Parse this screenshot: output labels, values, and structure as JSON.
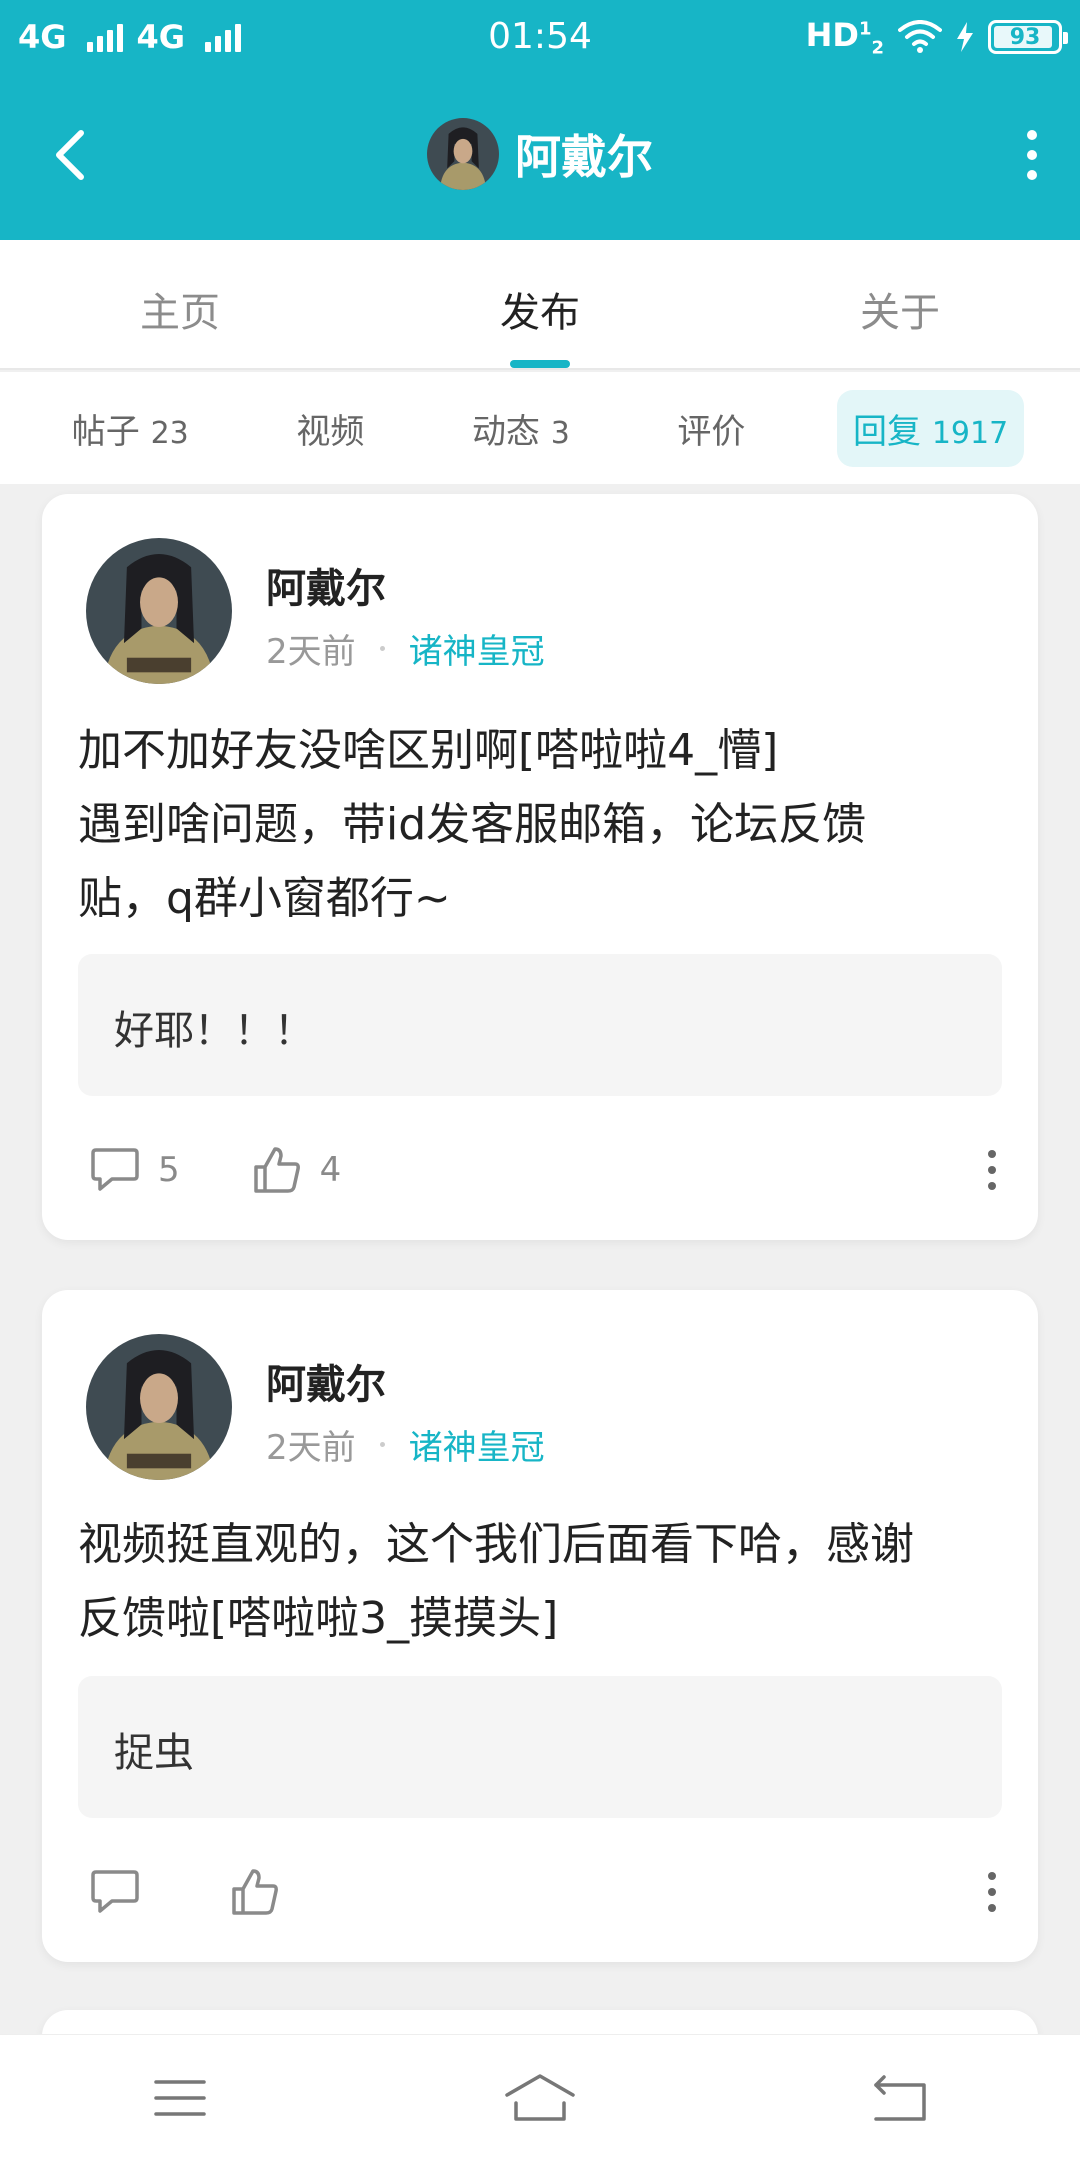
{
  "status_bar": {
    "left": [
      "4G",
      "4G"
    ],
    "time": "01:54",
    "hd": "HD",
    "hd_sup": "1",
    "hd_sub": "2",
    "battery": "93",
    "battery_level": 0.93
  },
  "header": {
    "title": "阿戴尔"
  },
  "tabs": [
    {
      "label": "主页"
    },
    {
      "label": "发布"
    },
    {
      "label": "关于"
    }
  ],
  "active_tab": "发布",
  "subtabs": [
    {
      "label": "帖子",
      "count": "23"
    },
    {
      "label": "视频",
      "count": ""
    },
    {
      "label": "动态",
      "count": "3"
    },
    {
      "label": "评价",
      "count": ""
    },
    {
      "label": "回复",
      "count": "1917"
    }
  ],
  "active_subtab": "回复",
  "posts": [
    {
      "author": "阿戴尔",
      "time": "2天前",
      "forum": "诸神皇冠",
      "lines": [
        "加不加好友没啥区别啊[嗒啦啦4_懵]",
        "遇到啥问题，带id发客服邮箱，论坛反馈",
        "贴，q群小窗都行~"
      ],
      "quote": "好耶！！！",
      "comments": "5",
      "likes": "4"
    },
    {
      "author": "阿戴尔",
      "time": "2天前",
      "forum": "诸神皇冠",
      "lines": [
        "视频挺直观的，这个我们后面看下哈，感谢",
        "反馈啦[嗒啦啦3_摸摸头]"
      ],
      "quote": "捉虫",
      "comments": "",
      "likes": ""
    }
  ],
  "colors": {
    "accent": "#17b5c6",
    "background": "#f0f0f0"
  },
  "icons": {
    "back": "back-arrow-icon",
    "more": "more-vertical-icon",
    "comment": "comment-icon",
    "like": "thumbs-up-icon",
    "nav_menu": "menu-icon",
    "nav_home": "home-icon",
    "nav_back": "return-icon"
  }
}
